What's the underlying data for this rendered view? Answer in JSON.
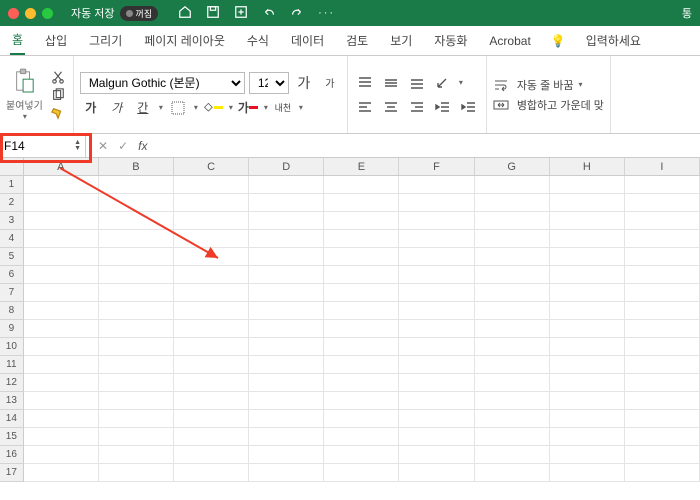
{
  "title_bar": {
    "autosave_label": "자동 저장",
    "autosave_state": "꺼짐",
    "right_text": "통"
  },
  "tabs": {
    "items": [
      "홈",
      "삽입",
      "그리기",
      "페이지 레이아웃",
      "수식",
      "데이터",
      "검토",
      "보기",
      "자동화",
      "Acrobat"
    ],
    "active_index": 0,
    "tell_me": "입력하세요"
  },
  "ribbon": {
    "paste_label": "붙여넣기",
    "font_name": "Malgun Gothic (본문)",
    "font_size": "12",
    "grow": "가",
    "shrink": "가",
    "bold": "가",
    "italic": "가",
    "underline": "간",
    "ruby": "내천",
    "wrap": "자동 줄 바꿈",
    "merge": "병합하고 가운데 맞"
  },
  "formula_bar": {
    "name_box": "F14",
    "cancel": "✕",
    "confirm": "✓",
    "fx": "fx"
  },
  "grid": {
    "columns": [
      "A",
      "B",
      "C",
      "D",
      "E",
      "F",
      "G",
      "H",
      "I"
    ],
    "rows": [
      1,
      2,
      3,
      4,
      5,
      6,
      7,
      8,
      9,
      10,
      11,
      12,
      13,
      14,
      15,
      16,
      17
    ]
  }
}
